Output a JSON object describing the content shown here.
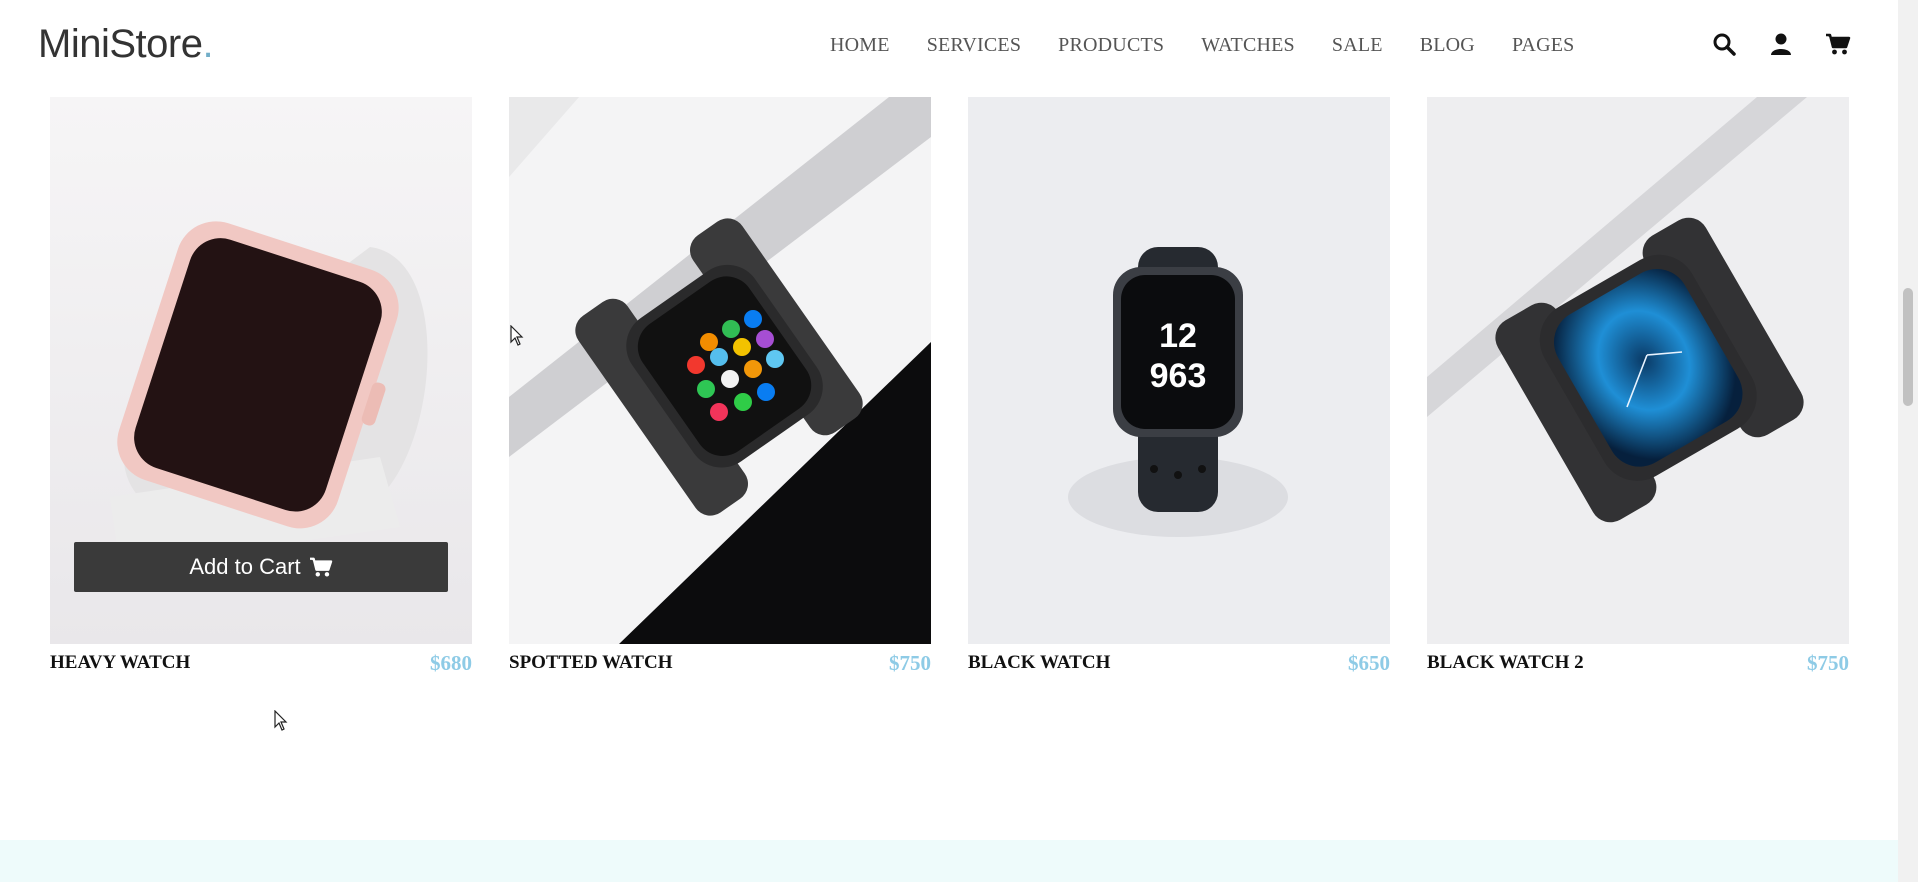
{
  "brand": {
    "name": "MiniStore",
    "dot": "."
  },
  "nav": {
    "items": [
      {
        "label": "HOME"
      },
      {
        "label": "SERVICES"
      },
      {
        "label": "PRODUCTS"
      },
      {
        "label": "WATCHES"
      },
      {
        "label": "SALE"
      },
      {
        "label": "BLOG"
      },
      {
        "label": "PAGES"
      }
    ]
  },
  "header_icons": [
    "search-icon",
    "user-icon",
    "cart-icon"
  ],
  "products": [
    {
      "title": "HEAVY WATCH",
      "price": "$680"
    },
    {
      "title": "SPOTTED WATCH",
      "price": "$750"
    },
    {
      "title": "BLACK WATCH",
      "price": "$650"
    },
    {
      "title": "BLACK WATCH 2",
      "price": "$750"
    }
  ],
  "add_to_cart": {
    "label": "Add to Cart"
  },
  "colors": {
    "accent": "#72aec8",
    "price": "#8ecbe6",
    "button_bg": "#3a3a3a",
    "band_bg": "#eefbfb"
  }
}
